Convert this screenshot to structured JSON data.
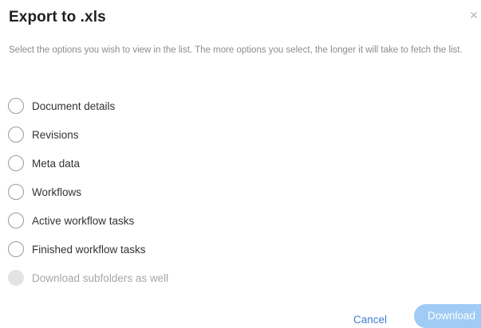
{
  "dialog": {
    "title": "Export to .xls",
    "close_icon": "close-icon",
    "description": "Select the options you wish to view in the list. The more options you select, the longer it will take to fetch the list."
  },
  "options": [
    {
      "label": "Document details",
      "selected": false,
      "enabled": true
    },
    {
      "label": "Revisions",
      "selected": false,
      "enabled": true
    },
    {
      "label": "Meta data",
      "selected": false,
      "enabled": true
    },
    {
      "label": "Workflows",
      "selected": false,
      "enabled": true
    },
    {
      "label": "Active workflow tasks",
      "selected": false,
      "enabled": true
    },
    {
      "label": "Finished workflow tasks",
      "selected": false,
      "enabled": true
    },
    {
      "label": "Download subfolders as well",
      "selected": false,
      "enabled": false
    }
  ],
  "footer": {
    "cancel_label": "Cancel",
    "download_label": "Download"
  },
  "colors": {
    "title_text": "#1f1f1f",
    "description_text": "#8c8c8c",
    "link_blue": "#3f7fd0",
    "download_button_disabled": "#9fcbf5",
    "radio_border": "#9a9a9a",
    "disabled_radio_fill": "#e3e3e3"
  }
}
